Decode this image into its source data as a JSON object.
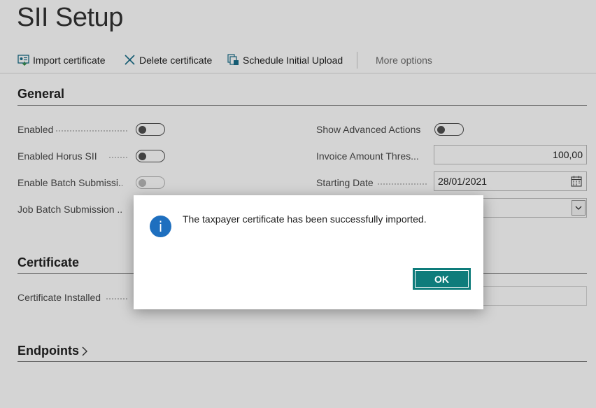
{
  "page": {
    "title": "SII Setup"
  },
  "actions": {
    "import_certificate": "Import certificate",
    "delete_certificate": "Delete certificate",
    "schedule_initial_upload": "Schedule Initial Upload",
    "more_options": "More options"
  },
  "general": {
    "title": "General",
    "enabled": {
      "label": "Enabled",
      "value": false
    },
    "enabled_horus": {
      "label": "Enabled Horus SII",
      "value": false
    },
    "enable_batch": {
      "label": "Enable Batch Submissi...",
      "value": false,
      "disabled": true
    },
    "job_batch": {
      "label": "Job Batch Submission ..."
    },
    "show_advanced": {
      "label": "Show Advanced Actions",
      "value": false
    },
    "invoice_amount": {
      "label": "Invoice Amount Thres...",
      "value": "100,00"
    },
    "starting_date": {
      "label": "Starting Date",
      "value": "28/01/2021"
    }
  },
  "certificate": {
    "title": "Certificate",
    "installed": {
      "label": "Certificate Installed"
    }
  },
  "endpoints": {
    "title": "Endpoints"
  },
  "dialog": {
    "message": "The taxpayer certificate has been successfully imported.",
    "ok_label": "OK",
    "icon": "info-icon"
  },
  "colors": {
    "accent": "#0e7c7b",
    "info": "#1e6fbf"
  }
}
